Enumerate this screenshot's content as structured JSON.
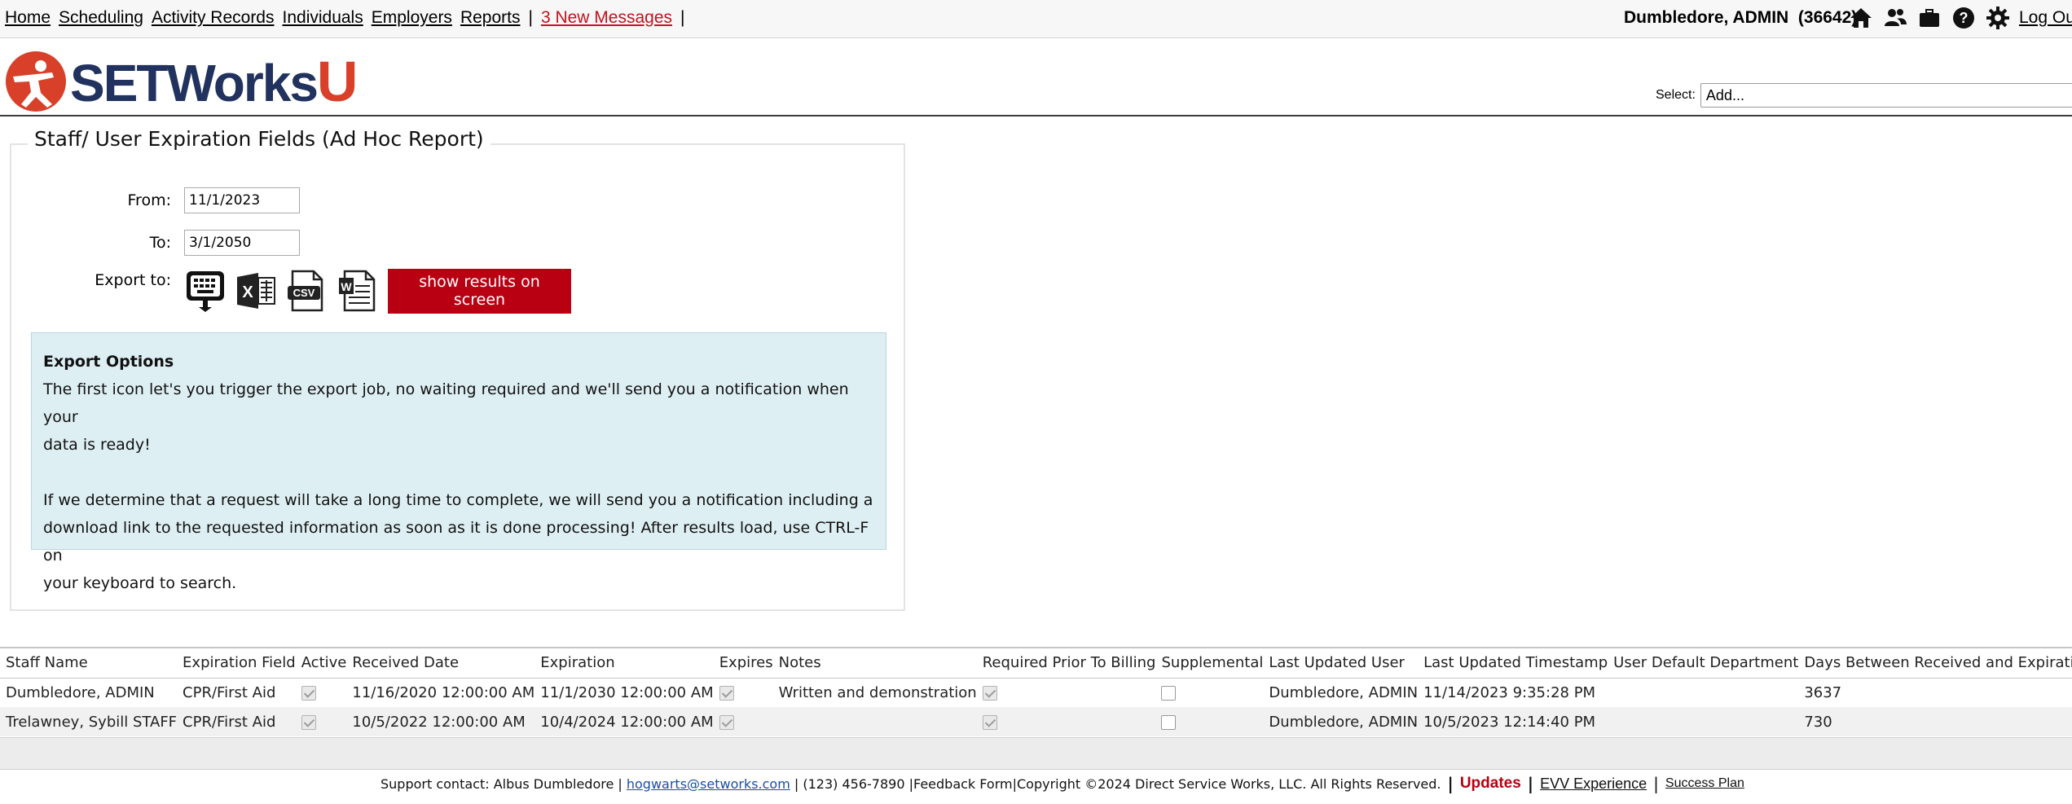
{
  "nav": {
    "items": [
      "Home",
      "Scheduling",
      "Activity Records",
      "Individuals",
      "Employers",
      "Reports"
    ],
    "separator": "|",
    "messages": "3 New Messages"
  },
  "header": {
    "user_name": "Dumbledore, ADMIN",
    "user_id": "(36642)",
    "icons": [
      "home-icon",
      "users-icon",
      "briefcase-icon",
      "help-icon",
      "settings-icon"
    ],
    "logout": "Log Ou"
  },
  "brand": {
    "logo_text": "SETWorks",
    "logo_u": "U",
    "colors": {
      "navy": "#22325f",
      "red": "#d8402a"
    }
  },
  "select": {
    "label": "Select:",
    "value": "Add..."
  },
  "report": {
    "title": "Staff/ User Expiration Fields (Ad Hoc Report)",
    "from_label": "From:",
    "from_value": "11/1/2023",
    "to_label": "To:",
    "to_value": "3/1/2050",
    "export_label": "Export to:",
    "export_icons": [
      "export-job-icon",
      "excel-icon",
      "csv-icon",
      "word-icon"
    ],
    "show_button": "show results on screen",
    "accent": "#b80012"
  },
  "export_options": {
    "heading": "Export Options",
    "line1": "The first icon let's you trigger the export job, no waiting required and we'll send you a notification when your",
    "line2": "data is ready!",
    "line3": "If we determine that a request will take a long time to complete, we will send you a notification including a",
    "line4": "download link to the requested information as soon as it is done processing! After results load, use CTRL-F on",
    "line5": "your keyboard to search."
  },
  "table": {
    "headers": [
      "Staff Name",
      "Expiration Field",
      "Active",
      "Received Date",
      "Expiration",
      "Expires",
      "Notes",
      "Required Prior To Billing",
      "Supplemental",
      "Last Updated User",
      "Last Updated Timestamp",
      "User Default Department",
      "Days Between Received and Expiration"
    ],
    "rows": [
      {
        "staff": "Dumbledore, ADMIN",
        "field": "CPR/First Aid",
        "active": true,
        "received": "11/16/2020 12:00:00 AM",
        "expiration": "11/1/2030 12:00:00 AM",
        "expires": true,
        "notes": "Written and demonstration",
        "required": true,
        "supplemental": false,
        "updated_user": "Dumbledore, ADMIN",
        "updated_ts": "11/14/2023 9:35:28 PM",
        "department": "",
        "days": "3637"
      },
      {
        "staff": "Trelawney, Sybill STAFF",
        "field": "CPR/First Aid",
        "active": true,
        "received": "10/5/2022 12:00:00 AM",
        "expiration": "10/4/2024 12:00:00 AM",
        "expires": true,
        "notes": "",
        "required": true,
        "supplemental": false,
        "updated_user": "Dumbledore, ADMIN",
        "updated_ts": "10/5/2023 12:14:40 PM",
        "department": "",
        "days": "730"
      }
    ]
  },
  "footer": {
    "support": "Support contact: Albus Dumbledore |",
    "email": "hogwarts@setworks.com",
    "phone": "| (123) 456-7890 |",
    "feedback": "Feedback Form",
    "copyright": "|Copyright ©2024 Direct Service Works, LLC. All Rights Reserved.",
    "bar": "|",
    "updates": "Updates",
    "evv": "EVV Experience",
    "success": "Success Plan"
  }
}
